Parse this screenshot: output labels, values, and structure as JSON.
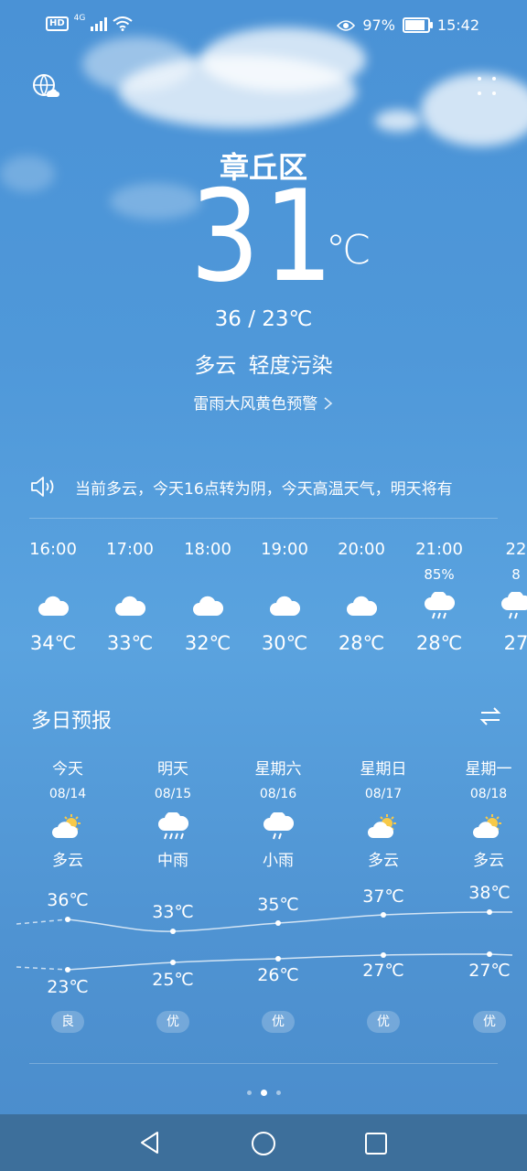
{
  "status_bar": {
    "hd_label": "HD",
    "network_label": "4G",
    "battery_percent": "97%",
    "battery_level": 0.97,
    "time": "15:42"
  },
  "header": {
    "city": "章丘区",
    "temperature": "31",
    "temp_unit": "℃",
    "range": "36 / 23℃",
    "condition": "多云  轻度污染",
    "warning": "雷雨大风黄色预警"
  },
  "ticker": {
    "text": "当前多云，今天16点转为阴，今天高温天气，明天将有"
  },
  "hourly": [
    {
      "time": "16:00",
      "precip": "",
      "icon": "cloud-icon",
      "temp": "34℃"
    },
    {
      "time": "17:00",
      "precip": "",
      "icon": "cloud-icon",
      "temp": "33℃"
    },
    {
      "time": "18:00",
      "precip": "",
      "icon": "cloud-icon",
      "temp": "32℃"
    },
    {
      "time": "19:00",
      "precip": "",
      "icon": "cloud-icon",
      "temp": "30℃"
    },
    {
      "time": "20:00",
      "precip": "",
      "icon": "cloud-icon",
      "temp": "28℃"
    },
    {
      "time": "21:00",
      "precip": "85%",
      "icon": "rain-cloud-icon",
      "temp": "28℃"
    },
    {
      "time": "22",
      "precip": "8",
      "icon": "rain-cloud-icon",
      "temp": "27"
    }
  ],
  "daily": {
    "title": "多日预报",
    "days": [
      {
        "name": "今天",
        "date": "08/14",
        "icon": "partly-cloudy-icon",
        "weather": "多云",
        "high": "36℃",
        "low": "23℃",
        "aqi": "良"
      },
      {
        "name": "明天",
        "date": "08/15",
        "icon": "rain-cloud-icon",
        "weather": "中雨",
        "high": "33℃",
        "low": "25℃",
        "aqi": "优"
      },
      {
        "name": "星期六",
        "date": "08/16",
        "icon": "light-rain-icon",
        "weather": "小雨",
        "high": "35℃",
        "low": "26℃",
        "aqi": "优"
      },
      {
        "name": "星期日",
        "date": "08/17",
        "icon": "partly-cloudy-icon",
        "weather": "多云",
        "high": "37℃",
        "low": "27℃",
        "aqi": "优"
      },
      {
        "name": "星期一",
        "date": "08/18",
        "icon": "partly-cloudy-icon",
        "weather": "多云",
        "high": "38℃",
        "low": "27℃",
        "aqi": "优"
      }
    ]
  }
}
